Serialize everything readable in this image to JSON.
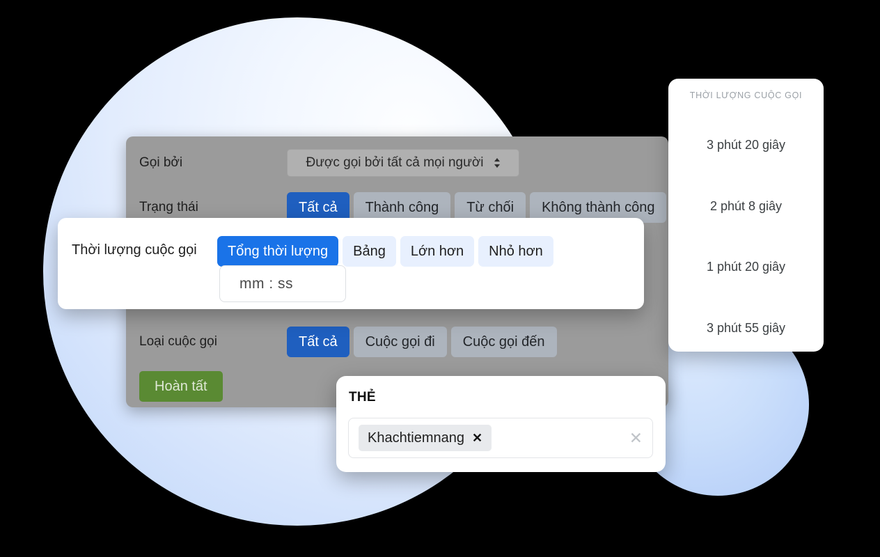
{
  "filter_panel": {
    "called_by": {
      "label": "Gọi bởi",
      "select_value": "Được gọi bởi tất cả mọi người",
      "select_icon": "stepper-updown-icon"
    },
    "status": {
      "label": "Trạng thái",
      "options": [
        {
          "label": "Tất cả",
          "active": true
        },
        {
          "label": "Thành công",
          "active": false
        },
        {
          "label": "Từ chối",
          "active": false
        },
        {
          "label": "Không thành công",
          "active": false
        }
      ]
    },
    "call_type": {
      "label": "Loại cuộc gọi",
      "options": [
        {
          "label": "Tất cả",
          "active": true
        },
        {
          "label": "Cuộc gọi đi",
          "active": false
        },
        {
          "label": "Cuộc gọi đến",
          "active": false
        }
      ]
    },
    "submit_label": "Hoàn tất"
  },
  "duration_card": {
    "label": "Thời lượng cuộc gọi",
    "options": [
      {
        "label": "Tổng thời lượng",
        "active": true
      },
      {
        "label": "Bảng",
        "active": false
      },
      {
        "label": "Lớn hơn",
        "active": false
      },
      {
        "label": "Nhỏ hơn",
        "active": false
      }
    ],
    "time_input_placeholder": "mm : ss"
  },
  "duration_list_card": {
    "header": "THỜI LƯỢNG CUỘC GỌI",
    "items": [
      "3 phút 20 giây",
      "2 phút 8 giây",
      "1 phút 20 giây",
      "3 phút 55 giây"
    ]
  },
  "tags_card": {
    "title": "THẺ",
    "tags": [
      {
        "label": "Khachtiemnang",
        "remove_icon": "✕"
      }
    ],
    "clear_icon": "✕"
  },
  "colors": {
    "accent_blue": "#1a73e8",
    "accent_blue_muted": "#1f5fbf",
    "chip_light_blue": "#e8f0fe",
    "submit_green": "#5a8a33",
    "panel_gray": "#9b9b9b"
  }
}
